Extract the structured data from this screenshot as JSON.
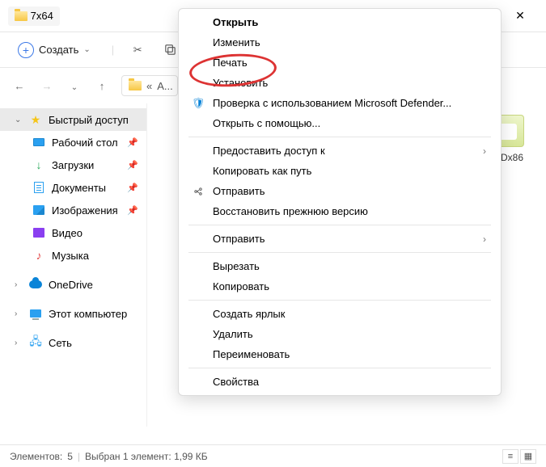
{
  "window": {
    "title": "7x64"
  },
  "toolbar": {
    "create_label": "Создать"
  },
  "addressbar": {
    "crumb_prefix": "«",
    "crumb": "A..."
  },
  "sidebar": {
    "quick_access": "Быстрый доступ",
    "desktop": "Рабочий стол",
    "downloads": "Загрузки",
    "documents": "Документы",
    "pictures": "Изображения",
    "videos": "Видео",
    "music": "Музыка",
    "onedrive": "OneDrive",
    "this_pc": "Этот компьютер",
    "network": "Сеть"
  },
  "files": {
    "right_item_label": "...ADx86"
  },
  "context_menu": {
    "open": "Открыть",
    "edit": "Изменить",
    "print": "Печать",
    "install": "Установить",
    "defender": "Проверка с использованием Microsoft Defender...",
    "open_with": "Открыть с помощью...",
    "give_access": "Предоставить доступ к",
    "copy_as_path": "Копировать как путь",
    "send": "Отправить",
    "restore_version": "Восстановить прежнюю версию",
    "send_to": "Отправить",
    "cut": "Вырезать",
    "copy": "Копировать",
    "create_shortcut": "Создать ярлык",
    "delete": "Удалить",
    "rename": "Переименовать",
    "properties": "Свойства"
  },
  "statusbar": {
    "elements_label": "Элементов:",
    "elements_count": "5",
    "selection": "Выбран 1 элемент: 1,99 КБ"
  }
}
